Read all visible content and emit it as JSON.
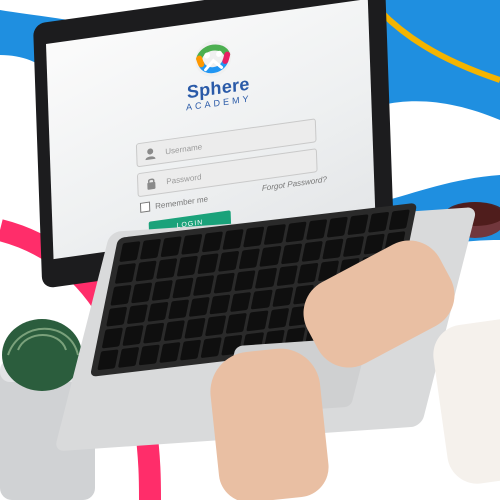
{
  "login_page": {
    "logo_icon": "sphere-figures-logo",
    "brand_name": "Sphere",
    "brand_sub": "ACADEMY",
    "username_placeholder": "Username",
    "password_placeholder": "Password",
    "remember_label": "Remember me",
    "forgot_label": "Forgot Password?",
    "login_label": "LOGIN"
  },
  "icons": {
    "user_icon": "user-icon",
    "lock_icon": "lock-icon",
    "checkbox_icon": "checkbox-icon"
  },
  "colors": {
    "brand_blue": "#2a5aa8",
    "login_green": "#1aa27a",
    "bg_blue": "#1f8fe0",
    "accent_pink": "#ff2d6a",
    "accent_yellow": "#f4b400"
  }
}
